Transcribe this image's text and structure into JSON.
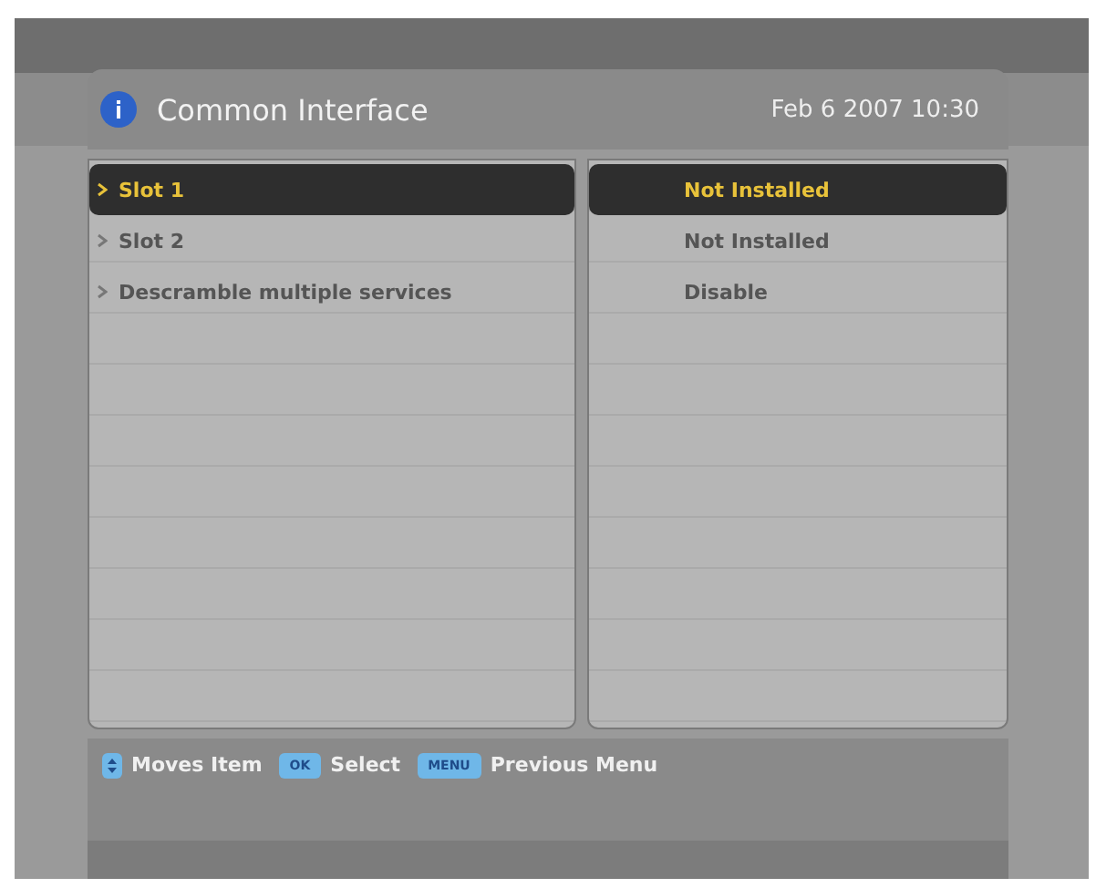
{
  "header": {
    "title": "Common Interface",
    "datetime": "Feb 6 2007 10:30"
  },
  "items": [
    {
      "label": "Slot 1",
      "value": "Not Installed",
      "selected": true
    },
    {
      "label": "Slot 2",
      "value": "Not Installed",
      "selected": false
    },
    {
      "label": "Descramble multiple services",
      "value": "Disable",
      "selected": false
    }
  ],
  "hints": [
    {
      "kind": "icon",
      "label": "Moves Item"
    },
    {
      "kind": "key",
      "key": "OK",
      "label": "Select"
    },
    {
      "kind": "key",
      "key": "MENU",
      "label": "Previous Menu"
    }
  ]
}
